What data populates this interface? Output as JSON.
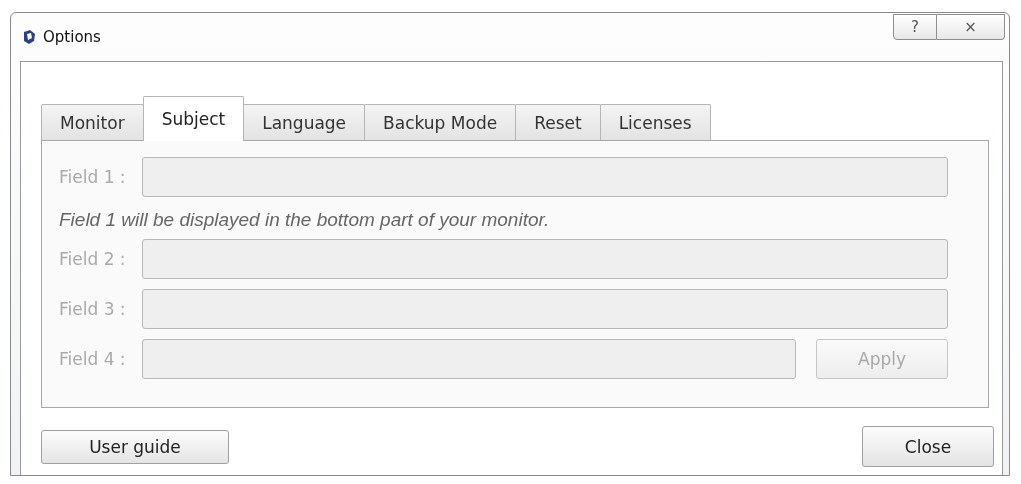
{
  "window": {
    "title": "Options",
    "help_button": "?",
    "close_button": "×"
  },
  "tabs": [
    {
      "label": "Monitor",
      "selected": false
    },
    {
      "label": "Subject",
      "selected": true
    },
    {
      "label": "Language",
      "selected": false
    },
    {
      "label": "Backup Mode",
      "selected": false
    },
    {
      "label": "Reset",
      "selected": false
    },
    {
      "label": "Licenses",
      "selected": false
    }
  ],
  "fields": [
    {
      "label": "Field 1 :",
      "disabled": true,
      "note": "Field 1 will be displayed in the bottom part of your monitor."
    },
    {
      "label": "Field 2 :",
      "disabled": true
    },
    {
      "label": "Field 3 :",
      "disabled": true
    },
    {
      "label": "Field 4 :",
      "disabled": true,
      "button": {
        "label": "Apply",
        "disabled": true
      }
    }
  ],
  "buttons": [
    {
      "label": "User guide",
      "kind": "left"
    },
    {
      "label": "Close",
      "kind": "right"
    }
  ]
}
